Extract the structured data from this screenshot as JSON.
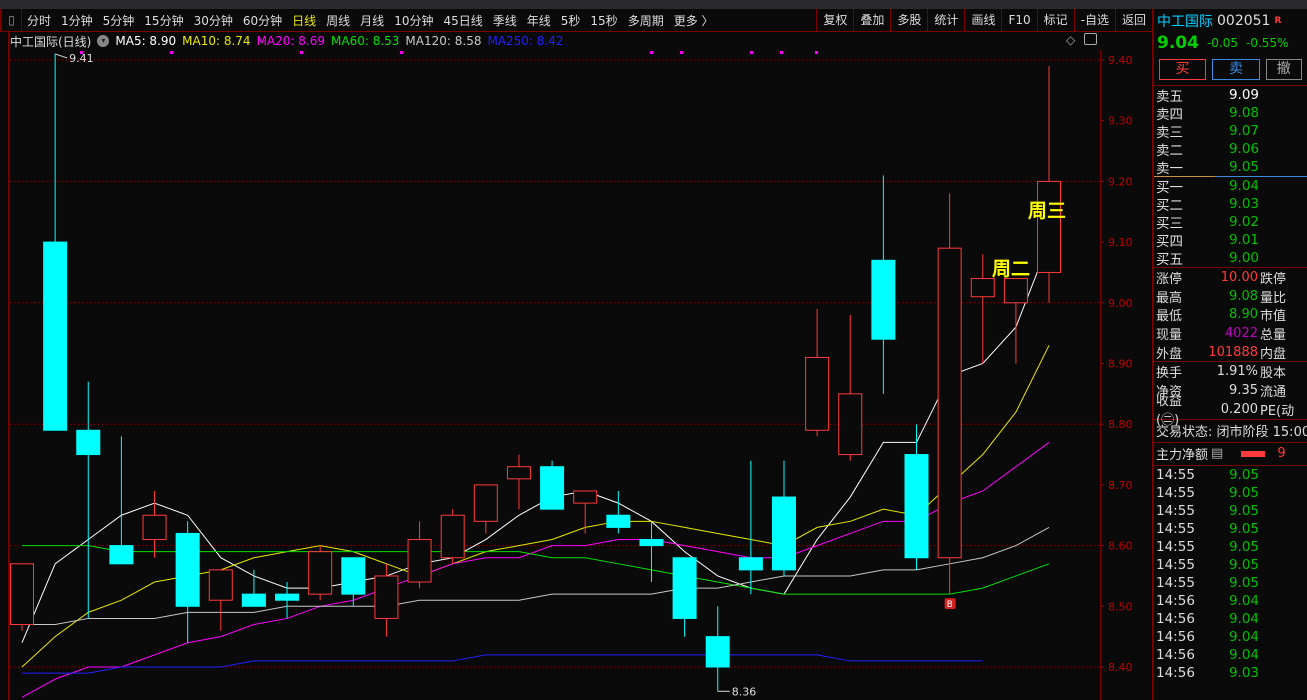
{
  "toolbar": {
    "periods": [
      "分时",
      "1分钟",
      "5分钟",
      "15分钟",
      "30分钟",
      "60分钟",
      "日线",
      "周线",
      "月线",
      "10分钟",
      "45日线",
      "季线",
      "年线",
      "5秒",
      "15秒",
      "多周期",
      "更多 〉"
    ],
    "active": "日线",
    "buttons": [
      "复权",
      "叠加",
      "多股",
      "统计",
      "画线",
      "F10",
      "标记",
      "-自选",
      "返回"
    ]
  },
  "info": {
    "title": "中工国际(日线)",
    "ma": [
      {
        "label": "MA5: 8.90",
        "color": "#ffffff"
      },
      {
        "label": "MA10: 8.74",
        "color": "#e8e800"
      },
      {
        "label": "MA20: 8.69",
        "color": "#ff00ff"
      },
      {
        "label": "MA60: 8.53",
        "color": "#00e000"
      },
      {
        "label": "MA120: 8.58",
        "color": "#c8c8c8"
      },
      {
        "label": "MA250: 8.42",
        "color": "#2020ff"
      }
    ]
  },
  "colors": {
    "up": "#ff3a3a",
    "down": "#00ffff",
    "axis": "#c00000",
    "annotation": "#ffff00"
  },
  "chart_data": {
    "type": "candlestick",
    "ylim": [
      8.35,
      9.45
    ],
    "yticks": [
      "9.40",
      "9.30",
      "9.20",
      "9.10",
      "9.00",
      "8.90",
      "8.80",
      "8.70",
      "8.60",
      "8.50",
      "8.40"
    ],
    "candles": [
      [
        8.47,
        8.57,
        8.57,
        8.46
      ],
      [
        9.1,
        8.79,
        9.41,
        8.79
      ],
      [
        8.79,
        8.75,
        8.87,
        8.48
      ],
      [
        8.6,
        8.57,
        8.78,
        8.57
      ],
      [
        8.61,
        8.65,
        8.69,
        8.58
      ],
      [
        8.62,
        8.5,
        8.64,
        8.44
      ],
      [
        8.51,
        8.56,
        8.56,
        8.46
      ],
      [
        8.52,
        8.5,
        8.56,
        8.5
      ],
      [
        8.52,
        8.51,
        8.54,
        8.48
      ],
      [
        8.52,
        8.59,
        8.6,
        8.51
      ],
      [
        8.58,
        8.52,
        8.58,
        8.5
      ],
      [
        8.48,
        8.55,
        8.57,
        8.45
      ],
      [
        8.54,
        8.61,
        8.64,
        8.53
      ],
      [
        8.58,
        8.65,
        8.66,
        8.57
      ],
      [
        8.64,
        8.7,
        8.7,
        8.62
      ],
      [
        8.71,
        8.73,
        8.75,
        8.66
      ],
      [
        8.73,
        8.66,
        8.74,
        8.66
      ],
      [
        8.67,
        8.69,
        8.69,
        8.62
      ],
      [
        8.65,
        8.63,
        8.69,
        8.62
      ],
      [
        8.61,
        8.6,
        8.64,
        8.54
      ],
      [
        8.58,
        8.48,
        8.58,
        8.45
      ],
      [
        8.45,
        8.4,
        8.5,
        8.36
      ],
      [
        8.58,
        8.56,
        8.74,
        8.52
      ],
      [
        8.68,
        8.56,
        8.74,
        8.55
      ],
      [
        8.79,
        8.91,
        8.99,
        8.78
      ],
      [
        8.75,
        8.85,
        8.98,
        8.74
      ],
      [
        9.07,
        8.94,
        9.21,
        8.85
      ],
      [
        8.75,
        8.58,
        8.8,
        8.56
      ],
      [
        8.58,
        9.09,
        9.18,
        8.52
      ],
      [
        9.01,
        9.04,
        9.08,
        8.9
      ],
      [
        9.0,
        9.04,
        9.04,
        8.9
      ],
      [
        9.05,
        9.2,
        9.39,
        9.0
      ]
    ],
    "candle_fields": [
      "open",
      "close",
      "high",
      "low"
    ],
    "ma_series": [
      {
        "name": "MA5",
        "color": "#ffffff",
        "values": [
          8.44,
          8.57,
          8.61,
          8.65,
          8.67,
          8.65,
          8.58,
          8.55,
          8.53,
          8.53,
          8.54,
          8.55,
          8.57,
          8.58,
          8.61,
          8.65,
          8.68,
          8.69,
          8.67,
          8.64,
          8.59,
          8.55,
          8.53,
          8.52,
          8.61,
          8.68,
          8.77,
          8.77,
          8.88,
          8.9,
          8.96,
          9.1
        ]
      },
      {
        "name": "MA10",
        "color": "#e8e800",
        "values": [
          8.4,
          8.45,
          8.49,
          8.51,
          8.54,
          8.55,
          8.56,
          8.58,
          8.59,
          8.6,
          8.59,
          8.57,
          8.55,
          8.57,
          8.59,
          8.6,
          8.61,
          8.63,
          8.64,
          8.64,
          8.63,
          8.62,
          8.61,
          8.6,
          8.63,
          8.64,
          8.66,
          8.65,
          8.7,
          8.75,
          8.82,
          8.93
        ]
      },
      {
        "name": "MA20",
        "color": "#ff00ff",
        "values": [
          8.35,
          8.38,
          8.4,
          8.4,
          8.42,
          8.44,
          8.45,
          8.47,
          8.48,
          8.5,
          8.51,
          8.53,
          8.55,
          8.57,
          8.58,
          8.58,
          8.6,
          8.6,
          8.61,
          8.61,
          8.6,
          8.59,
          8.58,
          8.58,
          8.6,
          8.62,
          8.64,
          8.64,
          8.67,
          8.69,
          8.73,
          8.77
        ]
      },
      {
        "name": "MA60",
        "color": "#00e000",
        "values": [
          8.6,
          8.6,
          8.6,
          8.59,
          8.59,
          8.59,
          8.59,
          8.59,
          8.59,
          8.59,
          8.59,
          8.59,
          8.59,
          8.59,
          8.59,
          8.59,
          8.58,
          8.58,
          8.57,
          8.56,
          8.55,
          8.54,
          8.53,
          8.52,
          8.52,
          8.52,
          8.52,
          8.52,
          8.52,
          8.53,
          8.55,
          8.57
        ]
      },
      {
        "name": "MA120",
        "color": "#c8c8c8",
        "values": [
          8.47,
          8.47,
          8.48,
          8.48,
          8.48,
          8.49,
          8.49,
          8.49,
          8.5,
          8.5,
          8.5,
          8.5,
          8.51,
          8.51,
          8.51,
          8.51,
          8.52,
          8.52,
          8.52,
          8.52,
          8.53,
          8.53,
          8.54,
          8.55,
          8.55,
          8.55,
          8.56,
          8.56,
          8.57,
          8.58,
          8.6,
          8.63
        ]
      },
      {
        "name": "MA250",
        "color": "#2020ff",
        "values": [
          8.39,
          8.39,
          8.39,
          8.4,
          8.4,
          8.4,
          8.4,
          8.41,
          8.41,
          8.41,
          8.41,
          8.41,
          8.41,
          8.41,
          8.42,
          8.42,
          8.42,
          8.42,
          8.42,
          8.42,
          8.42,
          8.42,
          8.42,
          8.42,
          8.42,
          8.41,
          8.41,
          8.41,
          8.41,
          8.41,
          null,
          null
        ]
      }
    ],
    "high_label": "9.41",
    "low_label": "8.36",
    "buy_marker": "B",
    "annotations": [
      "周二",
      "周三"
    ]
  },
  "panel": {
    "name": "中工国际",
    "code": "002051",
    "flag": "R",
    "price": "9.04",
    "change": "-0.05",
    "pct": "-0.55%",
    "buy": "买",
    "sell": "卖",
    "cancel": "撤",
    "asks": [
      {
        "l": "卖五",
        "v": "9.09",
        "c": "#ffffff"
      },
      {
        "l": "卖四",
        "v": "9.08"
      },
      {
        "l": "卖三",
        "v": "9.07"
      },
      {
        "l": "卖二",
        "v": "9.06"
      },
      {
        "l": "卖一",
        "v": "9.05"
      }
    ],
    "bids": [
      {
        "l": "买一",
        "v": "9.04"
      },
      {
        "l": "买二",
        "v": "9.03"
      },
      {
        "l": "买三",
        "v": "9.02"
      },
      {
        "l": "买四",
        "v": "9.01"
      },
      {
        "l": "买五",
        "v": "9.00"
      }
    ],
    "stats1": [
      {
        "l": "涨停",
        "v": "10.00",
        "c": "#ff3a3a",
        "r": "跌停"
      },
      {
        "l": "最高",
        "v": "9.08",
        "c": "#00c000",
        "r": "量比"
      },
      {
        "l": "最低",
        "v": "8.90",
        "c": "#00c000",
        "r": "市值"
      },
      {
        "l": "现量",
        "v": "4022",
        "c": "#c000c0",
        "r": "总量"
      },
      {
        "l": "外盘",
        "v": "101888",
        "c": "#ff3a3a",
        "r": "内盘"
      }
    ],
    "stats2": [
      {
        "l": "换手",
        "v": "1.91%",
        "c": "#ddd",
        "r": "股本"
      },
      {
        "l": "净资",
        "v": "9.35",
        "c": "#ddd",
        "r": "流通"
      },
      {
        "l": "收益(㊁)",
        "v": "0.200",
        "c": "#ddd",
        "r": "PE(动"
      }
    ],
    "status": "交易状态: 闭市阶段 15:00",
    "main_flow": "主力净额",
    "main_flow_val": "9",
    "ticks": [
      [
        "14:55",
        "9.05"
      ],
      [
        "14:55",
        "9.05"
      ],
      [
        "14:55",
        "9.05"
      ],
      [
        "14:55",
        "9.05"
      ],
      [
        "14:55",
        "9.05"
      ],
      [
        "14:55",
        "9.05"
      ],
      [
        "14:55",
        "9.05"
      ],
      [
        "14:56",
        "9.04"
      ],
      [
        "14:56",
        "9.04"
      ],
      [
        "14:56",
        "9.04"
      ],
      [
        "14:56",
        "9.04"
      ],
      [
        "14:56",
        "9.03"
      ]
    ]
  }
}
